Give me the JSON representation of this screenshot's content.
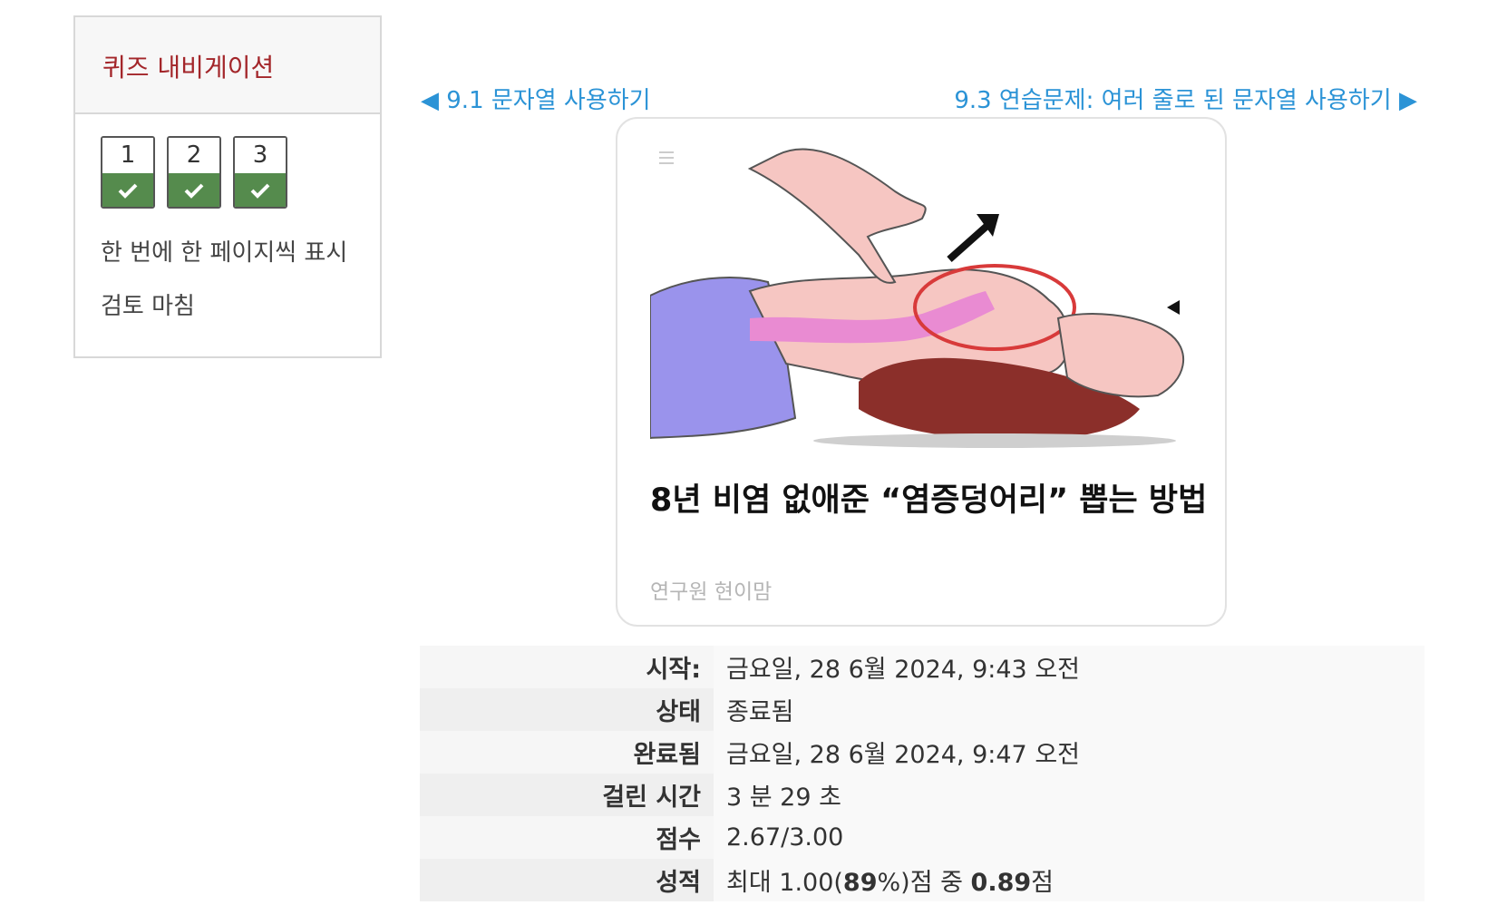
{
  "quiz_nav": {
    "title": "퀴즈 내비게이션",
    "questions": [
      {
        "number": "1",
        "state": "correct"
      },
      {
        "number": "2",
        "state": "correct"
      },
      {
        "number": "3",
        "state": "correct"
      }
    ],
    "show_one_page": "한 번에 한 페이지씩 표시",
    "finish_review": "검토 마침"
  },
  "nav": {
    "prev_arrow": "◀",
    "prev_label": "9.1 문자열 사용하기",
    "next_label": "9.3 연습문제: 여러 줄로 된 문자열 사용하기",
    "next_arrow": "▶"
  },
  "ad": {
    "menu_icon": "menu-icon",
    "headline": "8년 비염 없애준 “염증덩어리” 뽑는 방법",
    "source": "연구원 현이맘"
  },
  "summary": {
    "started_label": "시작:",
    "started_value": "금요일, 28 6월 2024, 9:43 오전",
    "state_label": "상태",
    "state_value": "종료됨",
    "completed_label": "완료됨",
    "completed_value": "금요일, 28 6월 2024, 9:47 오전",
    "time_label": "걸린 시간",
    "time_value": "3 분 29 초",
    "marks_label": "점수",
    "marks_value": "2.67/3.00",
    "grade_label": "성적",
    "grade_prefix": "최대 1.00(",
    "grade_percent": "89",
    "grade_middle": "%)점 중 ",
    "grade_score": "0.89",
    "grade_suffix": "점"
  },
  "colors": {
    "accent_red": "#a3262a",
    "link_blue": "#2b93d6",
    "correct_green": "#558b4d"
  }
}
